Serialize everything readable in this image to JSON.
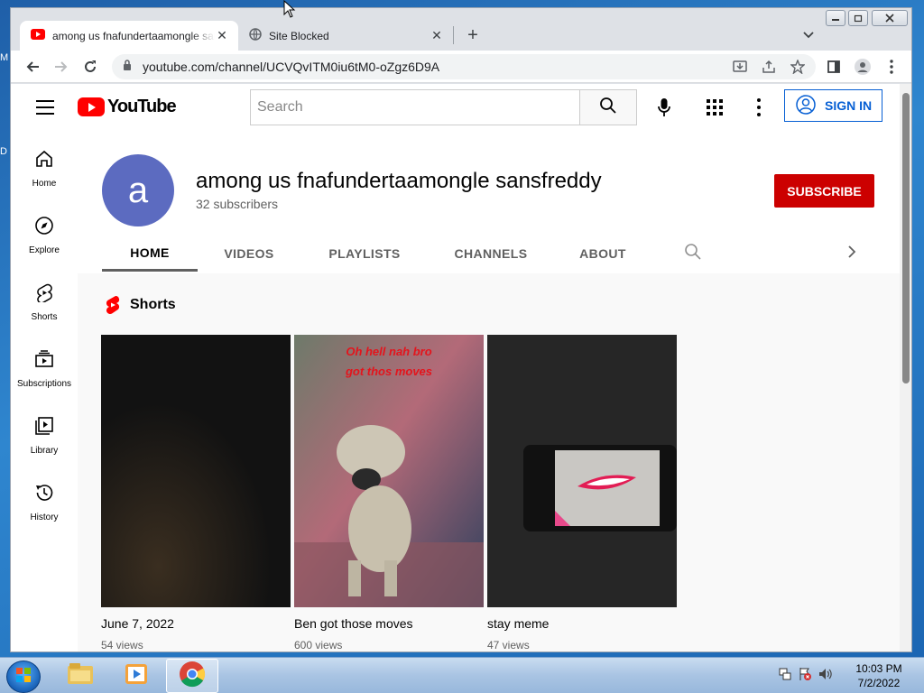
{
  "desktop": {
    "peek_top": "M",
    "peek_mid": "D"
  },
  "browser": {
    "tabs": [
      {
        "title": "among us fnafundertaamongle sansfreddy - YouTube",
        "icon": "youtube-favicon",
        "active": true
      },
      {
        "title": "Site Blocked",
        "icon": "globe-icon",
        "active": false
      }
    ],
    "new_tab_label": "+",
    "url": "youtube.com/channel/UCVQvITM0iu6tM0-oZgz6D9A",
    "window_buttons": [
      "minimize",
      "restore",
      "close"
    ]
  },
  "youtube": {
    "logo_text": "YouTube",
    "search_placeholder": "Search",
    "sign_in_label": "SIGN IN",
    "guide": [
      {
        "label": "Home",
        "icon": "home-icon"
      },
      {
        "label": "Explore",
        "icon": "compass-icon"
      },
      {
        "label": "Shorts",
        "icon": "shorts-icon"
      },
      {
        "label": "Subscriptions",
        "icon": "subscriptions-icon"
      },
      {
        "label": "Library",
        "icon": "library-icon"
      },
      {
        "label": "History",
        "icon": "history-icon"
      }
    ],
    "channel": {
      "avatar_letter": "a",
      "avatar_color": "#5c6bc0",
      "name": "among us fnafundertaamongle sansfreddy",
      "subscribers": "32 subscribers",
      "subscribe_label": "SUBSCRIBE",
      "tabs": [
        "HOME",
        "VIDEOS",
        "PLAYLISTS",
        "CHANNELS",
        "ABOUT"
      ],
      "active_tab": "HOME"
    },
    "shelf": {
      "title": "Shorts",
      "items": [
        {
          "title": "June 7, 2022",
          "views": "54 views",
          "overlay": ""
        },
        {
          "title": "Ben got those moves",
          "views": "600 views",
          "overlay_line1": "Oh hell nah bro",
          "overlay_line2": "got thos moves"
        },
        {
          "title": "stay meme",
          "views": "47 views",
          "overlay": ""
        }
      ]
    }
  },
  "taskbar": {
    "apps": [
      "explorer-icon",
      "media-player-icon",
      "chrome-icon"
    ],
    "active_app": "chrome-icon",
    "time": "10:03 PM",
    "date": "7/2/2022"
  },
  "colors": {
    "youtube_red": "#ff0000",
    "subscribe_red": "#cc0000",
    "link_blue": "#065fd4"
  }
}
